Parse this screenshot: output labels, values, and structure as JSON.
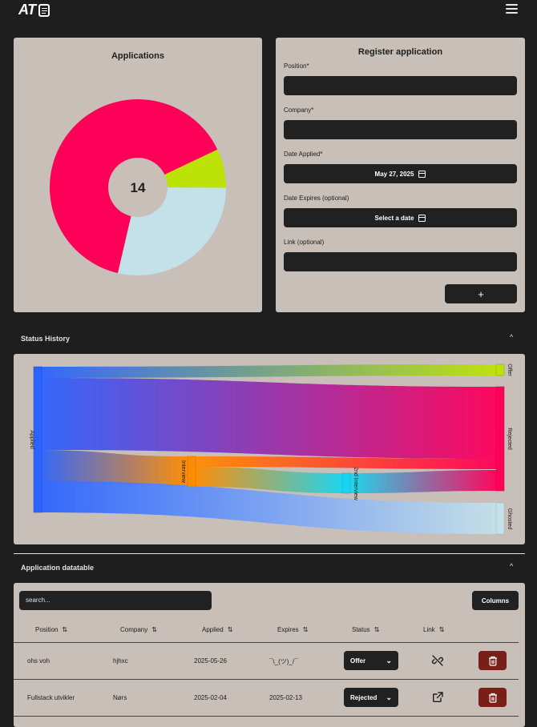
{
  "app": {
    "logo_text": "AT",
    "menu_icon": "hamburger-icon"
  },
  "applications_card": {
    "title": "Applications",
    "total": "14"
  },
  "pie": {
    "slices": [
      {
        "label": "Rejected",
        "value": 9,
        "color": "#ff0059"
      },
      {
        "label": "Offer",
        "value": 1,
        "color": "#bde207"
      },
      {
        "label": "Ghosted",
        "value": 4,
        "color": "#c4e0e9"
      }
    ]
  },
  "register": {
    "title": "Register application",
    "position_label": "Position*",
    "company_label": "Company*",
    "date_applied_label": "Date Applied*",
    "date_applied_value": "May 27, 2025",
    "date_expires_label": "Date Expires (optional)",
    "date_expires_value": "Select a date",
    "link_label": "Link (optional)",
    "add_label": "+"
  },
  "status_history": {
    "title": "Status History",
    "nodes": {
      "applied": "Applied",
      "interview": "Interview",
      "second_interview": "2nd Interview",
      "offer": "Offer",
      "rejected": "Rejected",
      "ghosted": "Ghosted"
    },
    "colors": {
      "applied": "#2c63ff",
      "interview": "#ff8c00",
      "second_interview": "#18d6ef",
      "offer": "#bde207",
      "rejected": "#ff0059",
      "ghosted": "#c4e0e9"
    }
  },
  "datatable": {
    "title": "Application datatable",
    "search_placeholder": "search...",
    "columns_label": "Columns",
    "headers": [
      "Position",
      "Company",
      "Applied",
      "Expires",
      "Status",
      "Link"
    ],
    "sort_icon": "⇅",
    "rows": [
      {
        "position": "ohs voh",
        "company": "hjhxc",
        "applied": "2025-05-26",
        "expires": "¯\\_(ツ)_/¯",
        "status": "Offer",
        "link": "link-off-icon"
      },
      {
        "position": "Fullstack utvikler",
        "company": "Nørs",
        "applied": "2025-02-04",
        "expires": "2025-02-13",
        "status": "Rejected",
        "link": "external-link-icon"
      }
    ]
  }
}
